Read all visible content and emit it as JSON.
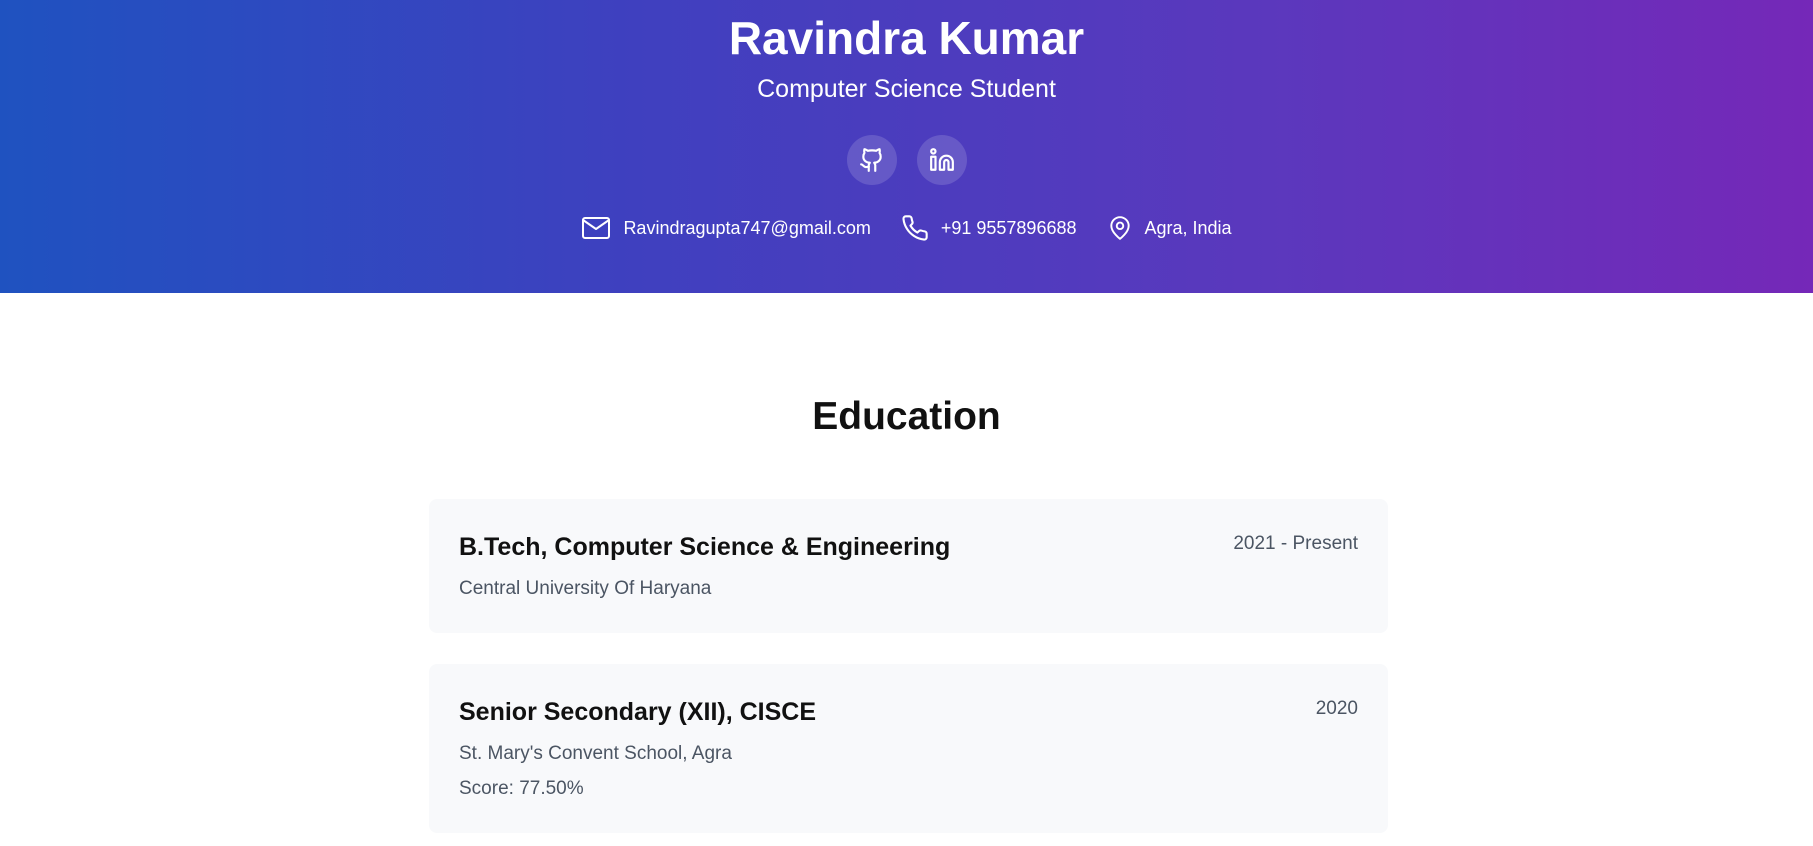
{
  "header": {
    "name": "Ravindra Kumar",
    "role": "Computer Science Student",
    "socials": [
      {
        "icon": "github-icon"
      },
      {
        "icon": "linkedin-icon"
      }
    ],
    "contacts": {
      "email": "Ravindragupta747@gmail.com",
      "phone": "+91 9557896688",
      "location": "Agra, India"
    },
    "colors": {
      "gradient_start": "#1f52c0",
      "gradient_end": "#7528b8"
    }
  },
  "education": {
    "title": "Education",
    "entries": [
      {
        "degree": "B.Tech, Computer Science & Engineering",
        "institution": "Central University Of Haryana",
        "period": "2021 - Present"
      },
      {
        "degree": "Senior Secondary (XII), CISCE",
        "institution": "St. Mary's Convent School, Agra",
        "period": "2020",
        "score": "Score: 77.50%"
      }
    ]
  }
}
